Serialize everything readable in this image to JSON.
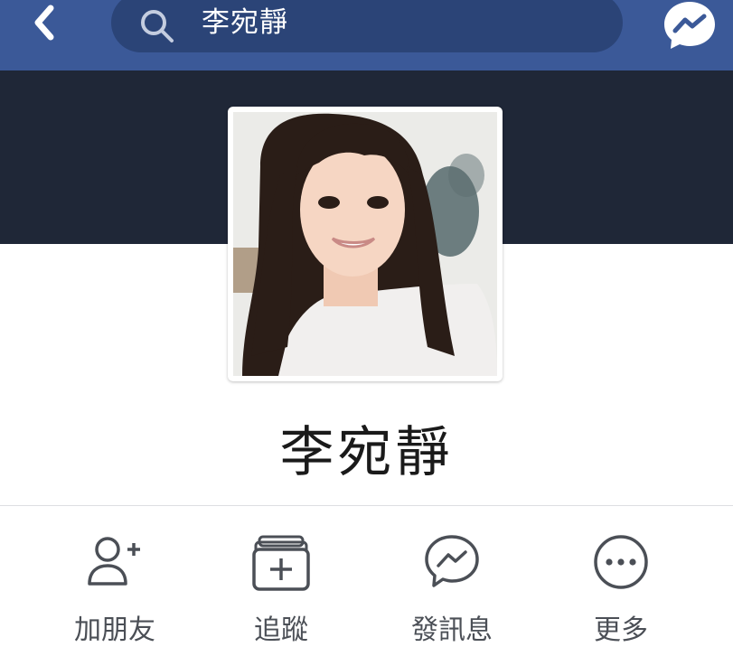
{
  "header": {
    "search_text": "李宛靜"
  },
  "profile": {
    "name": "李宛靜"
  },
  "actions": [
    {
      "label": "加朋友"
    },
    {
      "label": "追蹤"
    },
    {
      "label": "發訊息"
    },
    {
      "label": "更多"
    }
  ],
  "icons": {
    "back": "chevron-left-icon",
    "search": "search-icon",
    "messenger": "messenger-icon",
    "add_friend": "add-friend-icon",
    "follow": "follow-icon",
    "message": "messenger-icon",
    "more": "more-icon"
  },
  "colors": {
    "brand_bar": "#3b5998",
    "search_pill": "#2b4477",
    "cover": "#1f2737",
    "icon_gray": "#4b4f56"
  }
}
